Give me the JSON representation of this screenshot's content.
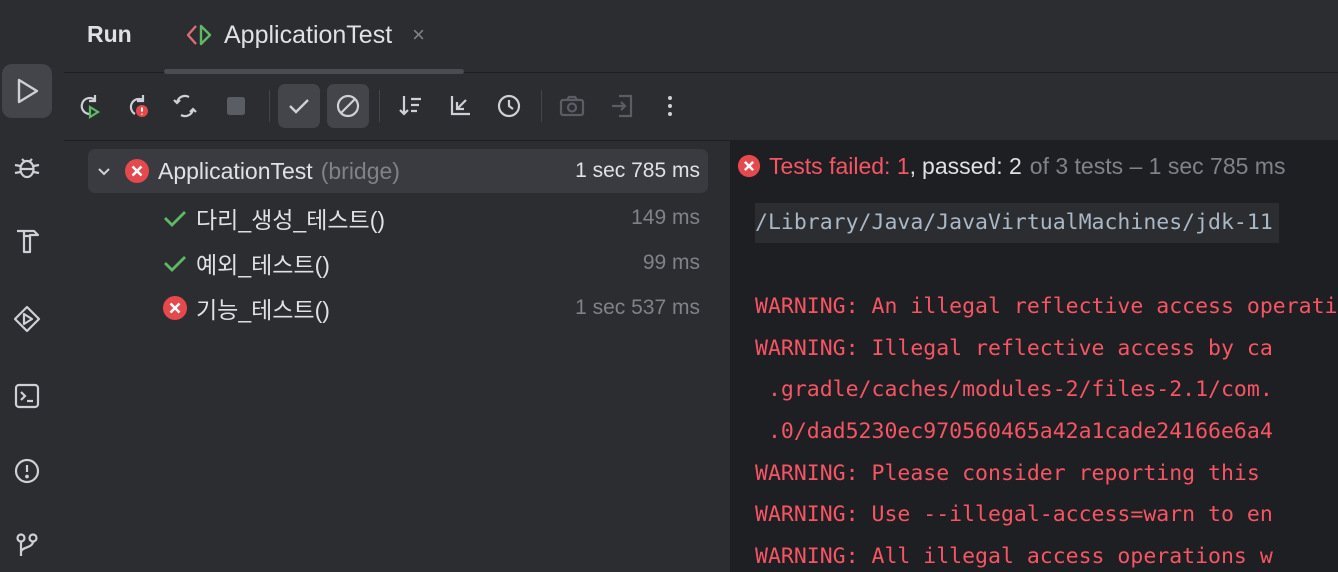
{
  "sidebar": {
    "items": [
      {
        "name": "run",
        "icon": "run-icon",
        "active": true
      },
      {
        "name": "debug",
        "icon": "bug-icon",
        "active": false
      },
      {
        "name": "build",
        "icon": "hammer-icon",
        "active": false
      },
      {
        "name": "services",
        "icon": "services-icon",
        "active": false
      },
      {
        "name": "terminal",
        "icon": "terminal-icon",
        "active": false
      },
      {
        "name": "problems",
        "icon": "problems-icon",
        "active": false
      },
      {
        "name": "git",
        "icon": "git-icon",
        "active": false
      }
    ]
  },
  "tabbar": {
    "run_label": "Run",
    "tab_title": "ApplicationTest",
    "close_glyph": "×"
  },
  "toolbar": {
    "buttons": [
      "rerun",
      "rerun-failed",
      "toggle-auto-test",
      "stop",
      "show-passed",
      "show-ignored",
      "sort",
      "collapse",
      "history",
      "screenshot",
      "export",
      "more"
    ]
  },
  "tree": {
    "root": {
      "name": "ApplicationTest",
      "sub": "(bridge)",
      "time": "1 sec 785 ms",
      "status": "failed"
    },
    "children": [
      {
        "name": "다리_생성_테스트()",
        "time": "149 ms",
        "status": "passed"
      },
      {
        "name": "예외_테스트()",
        "time": "99 ms",
        "status": "passed"
      },
      {
        "name": "기능_테스트()",
        "time": "1 sec 537 ms",
        "status": "failed"
      }
    ]
  },
  "console": {
    "status": {
      "failed_label": "Tests failed: 1",
      "comma": ",",
      "passed_label": "passed: 2",
      "rest": "of 3 tests – 1 sec 785 ms"
    },
    "command": "/Library/Java/JavaVirtualMachines/jdk-11",
    "lines": [
      "WARNING: An illegal reflective access operation has occurred",
      "WARNING: Illegal reflective access by ca",
      " .gradle/caches/modules-2/files-2.1/com.",
      " .0/dad5230ec970560465a42a1cade24166e6a4",
      "WARNING: Please consider reporting this",
      "WARNING: Use --illegal-access=warn to en",
      "WARNING: All illegal access operations w"
    ]
  },
  "colors": {
    "fail": "#f75464",
    "pass": "#5fb865",
    "bg": "#2b2d30",
    "console_bg": "#1e1f22"
  }
}
